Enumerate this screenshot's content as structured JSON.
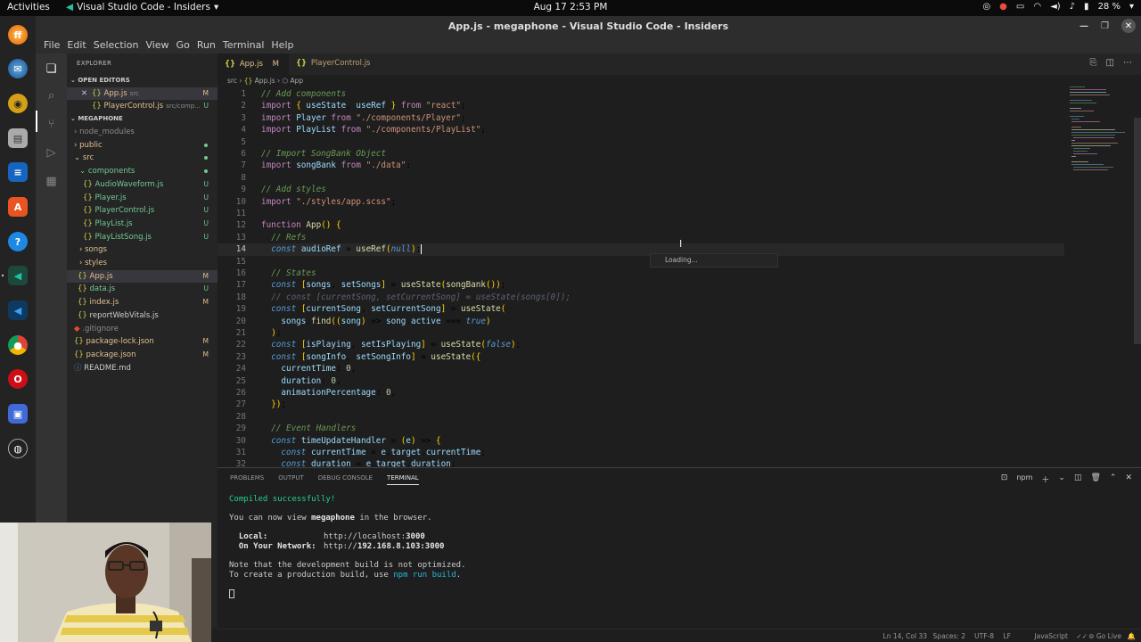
{
  "topbar": {
    "activities": "Activities",
    "app_name": "Visual Studio Code - Insiders",
    "clock": "Aug 17  2:53 PM",
    "battery": "28 %"
  },
  "window": {
    "title": "App.js - megaphone - Visual Studio Code - Insiders",
    "menus": [
      "File",
      "Edit",
      "Selection",
      "View",
      "Go",
      "Run",
      "Terminal",
      "Help"
    ]
  },
  "explorer": {
    "header": "EXPLORER",
    "open_editors_label": "OPEN EDITORS",
    "open_editors": [
      {
        "name": "App.js",
        "path": "src",
        "badge": "M"
      },
      {
        "name": "PlayerControl.js",
        "path": "src/comp...",
        "badge": "U"
      }
    ],
    "project_label": "MEGAPHONE",
    "tree": [
      {
        "name": "node_modules",
        "badge": ""
      },
      {
        "name": "public",
        "badge": ""
      },
      {
        "name": "src",
        "badge": ""
      },
      {
        "name": "components",
        "badge": ""
      },
      {
        "name": "AudioWaveform.js",
        "badge": "U"
      },
      {
        "name": "Player.js",
        "badge": "U"
      },
      {
        "name": "PlayerControl.js",
        "badge": "U"
      },
      {
        "name": "PlayList.js",
        "badge": "U"
      },
      {
        "name": "PlayListSong.js",
        "badge": "U"
      },
      {
        "name": "songs",
        "badge": ""
      },
      {
        "name": "styles",
        "badge": ""
      },
      {
        "name": "App.js",
        "badge": "M"
      },
      {
        "name": "data.js",
        "badge": "U"
      },
      {
        "name": "index.js",
        "badge": "M"
      },
      {
        "name": "reportWebVitals.js",
        "badge": ""
      },
      {
        "name": ".gitignore",
        "badge": ""
      },
      {
        "name": "package-lock.json",
        "badge": "M"
      },
      {
        "name": "package.json",
        "badge": "M"
      },
      {
        "name": "README.md",
        "badge": ""
      }
    ]
  },
  "tabs": [
    {
      "label": "App.js",
      "badge": "M",
      "icon": "{}"
    },
    {
      "label": "PlayerControl.js",
      "badge": "U",
      "icon": "{}"
    }
  ],
  "breadcrumb": {
    "folder": "src",
    "file": "App.js",
    "symbol": "App"
  },
  "editor": {
    "line_numbers": [
      "1",
      "2",
      "3",
      "4",
      "5",
      "6",
      "7",
      "8",
      "9",
      "10",
      "11",
      "12",
      "13",
      "14",
      "15",
      "16",
      "17",
      "18",
      "19",
      "20",
      "21",
      "22",
      "23",
      "24",
      "25",
      "26",
      "27",
      "28",
      "29",
      "30",
      "31",
      "32"
    ],
    "lines": [
      "// Add components",
      "import { useState, useRef } from \"react\";",
      "import Player from \"./components/Player\";",
      "import PlayList from \"./components/PlayList\";",
      "",
      "// Import SongBank Object",
      "import songBank from \"./data\";",
      "",
      "// Add styles",
      "import \"./styles/app.scss\";",
      "",
      "function App() {",
      "  // Refs",
      "  const audioRef = useRef(null);",
      "",
      "  // States",
      "  const [songs, setSongs] = useState(songBank());",
      "  // const [currentSong, setCurrentSong] = useState(songs[0]);",
      "  const [currentSong, setCurrentSong] = useState(",
      "    songs.find((song) => song.active === true)",
      "  );",
      "  const [isPlaying, setIsPlaying] = useState(false);",
      "  const [songInfo, setSongInfo] = useState({",
      "    currentTime: 0,",
      "    duration: 0,",
      "    animationPercentage: 0,",
      "  });",
      "",
      "  // Event Handlers",
      "  const timeUpdateHandler = (e) => {",
      "    const currentTime = e.target.currentTime;",
      "    const duration = e.target.duration;"
    ],
    "loading": "Loading..."
  },
  "panel": {
    "tabs": [
      "PROBLEMS",
      "OUTPUT",
      "DEBUG CONSOLE",
      "TERMINAL"
    ],
    "terminal_name": "npm",
    "terminal": {
      "compiled": "Compiled successfully!",
      "view_prefix": "You can now view ",
      "app": "megaphone",
      "view_suffix": " in the browser.",
      "local_label": "  Local:",
      "local_url_prefix": "http://localhost:",
      "local_port": "3000",
      "network_label": "  On Your Network:",
      "network_url_prefix": "http://",
      "network_host": "192.168.8.103:3000",
      "note1": "Note that the development build is not optimized.",
      "note2_prefix": "To create a production build, use ",
      "note2_cmd": "npm run build",
      "note2_suffix": "."
    }
  },
  "statusbar": {
    "position": "Ln 14, Col 33",
    "spaces": "Spaces: 2",
    "encoding": "UTF-8",
    "eol": "LF",
    "language": "JavaScript",
    "golive": "Go Live"
  }
}
